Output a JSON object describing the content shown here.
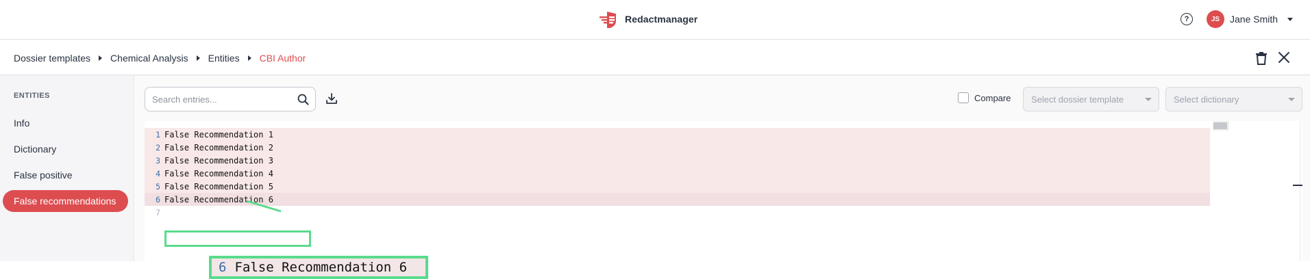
{
  "header": {
    "brand": "Redactmanager",
    "help_icon_glyph": "?",
    "user": {
      "initials": "JS",
      "name": "Jane Smith"
    },
    "accent_color": "#dd4d50"
  },
  "breadcrumb": {
    "items": [
      "Dossier templates",
      "Chemical Analysis",
      "Entities",
      "CBI Author"
    ]
  },
  "sidebar": {
    "heading": "ENTITIES",
    "items": [
      {
        "label": "Info",
        "active": false
      },
      {
        "label": "Dictionary",
        "active": false
      },
      {
        "label": "False positive",
        "active": false
      },
      {
        "label": "False recommendations",
        "active": true
      }
    ]
  },
  "toolbar": {
    "search_placeholder": "Search entries...",
    "search_value": "",
    "compare_label": "Compare",
    "compare_checked": false,
    "template_select_placeholder": "Select dossier template",
    "dictionary_select_placeholder": "Select dictionary"
  },
  "editor": {
    "lines": [
      {
        "number": "1",
        "text": "False Recommendation 1"
      },
      {
        "number": "2",
        "text": "False Recommendation 2"
      },
      {
        "number": "3",
        "text": "False Recommendation 3"
      },
      {
        "number": "4",
        "text": "False Recommendation 4"
      },
      {
        "number": "5",
        "text": "False Recommendation 5"
      },
      {
        "number": "6",
        "text": "False Recommendation 6"
      },
      {
        "number": "7",
        "text": ""
      }
    ],
    "highlight_color": "#f9e8e8"
  },
  "callout": {
    "number": "6",
    "text": "False Recommendation 6",
    "color": "#5bdb8c"
  }
}
